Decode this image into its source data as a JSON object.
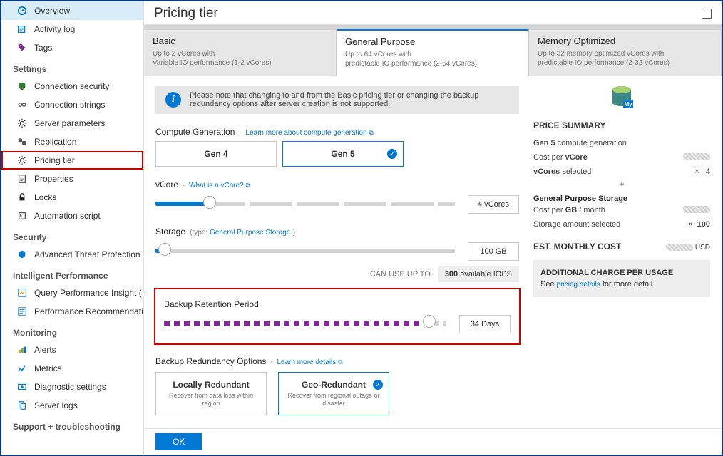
{
  "sidebar": {
    "items": [
      {
        "label": "Overview",
        "icon": "overview",
        "color": "#0078d4",
        "selected": true
      },
      {
        "label": "Activity log",
        "icon": "activity",
        "color": "#0078d4"
      },
      {
        "label": "Tags",
        "icon": "tags",
        "color": "#7b2d8e"
      }
    ],
    "groups": [
      {
        "heading": "Settings",
        "items": [
          {
            "label": "Connection security",
            "icon": "shield",
            "color": "#2f7d32"
          },
          {
            "label": "Connection strings",
            "icon": "strings",
            "color": "#555"
          },
          {
            "label": "Server parameters",
            "icon": "gear",
            "color": "#333"
          },
          {
            "label": "Replication",
            "icon": "replication",
            "color": "#555"
          },
          {
            "label": "Pricing tier",
            "icon": "gear",
            "color": "#555",
            "highlight": true
          },
          {
            "label": "Properties",
            "icon": "properties",
            "color": "#555"
          },
          {
            "label": "Locks",
            "icon": "lock",
            "color": "#222"
          },
          {
            "label": "Automation script",
            "icon": "script",
            "color": "#555"
          }
        ]
      },
      {
        "heading": "Security",
        "items": [
          {
            "label": "Advanced Threat Protection (...",
            "icon": "shield-blue",
            "color": "#0078d4"
          }
        ]
      },
      {
        "heading": "Intelligent Performance",
        "items": [
          {
            "label": "Query Performance Insight (...",
            "icon": "chart",
            "color": "#0078d4"
          },
          {
            "label": "Performance Recommendatio...",
            "icon": "list",
            "color": "#0078d4"
          }
        ]
      },
      {
        "heading": "Monitoring",
        "items": [
          {
            "label": "Alerts",
            "icon": "alert",
            "color": "#e8a800"
          },
          {
            "label": "Metrics",
            "icon": "metrics",
            "color": "#0078d4"
          },
          {
            "label": "Diagnostic settings",
            "icon": "diagnostic",
            "color": "#0078d4"
          },
          {
            "label": "Server logs",
            "icon": "logs",
            "color": "#0078d4"
          }
        ]
      },
      {
        "heading": "Support + troubleshooting",
        "items": []
      }
    ]
  },
  "header": {
    "title": "Pricing tier"
  },
  "tiers": [
    {
      "title": "Basic",
      "desc1": "Up to 2 vCores with",
      "desc2": "Variable IO performance (1-2 vCores)"
    },
    {
      "title": "General Purpose",
      "desc1": "Up to 64 vCores with",
      "desc2": "predictable IO performance (2-64 vCores)",
      "active": true
    },
    {
      "title": "Memory Optimized",
      "desc1": "Up to 32 memory optimized vCores with",
      "desc2": "predictable IO performance (2-32 vCores)"
    }
  ],
  "info_note": "Please note that changing to and from the Basic pricing tier or changing the backup redundancy options after server creation is not supported.",
  "compute": {
    "label": "Compute Generation",
    "link": "Learn more about compute generation",
    "options": [
      {
        "label": "Gen 4"
      },
      {
        "label": "Gen 5",
        "selected": true
      }
    ]
  },
  "vcore": {
    "label": "vCore",
    "link": "What is a vCore?",
    "value": "4 vCores",
    "fill_pct": 18
  },
  "storage": {
    "label": "Storage",
    "type_word": "type:",
    "type_link": "General Purpose Storage",
    "value": "100 GB",
    "fill_pct": 3,
    "can_use": "CAN USE UP TO",
    "iops": "300",
    "iops_suffix": "available IOPS"
  },
  "backup": {
    "label": "Backup Retention Period",
    "value": "34 Days",
    "fill_pct": 94
  },
  "redundancy": {
    "label": "Backup Redundancy Options",
    "link": "Learn more details",
    "options": [
      {
        "title": "Locally Redundant",
        "desc": "Recover from data loss within region"
      },
      {
        "title": "Geo-Redundant",
        "desc": "Recover from regional outage or disaster",
        "selected": true
      }
    ]
  },
  "price": {
    "title": "PRICE SUMMARY",
    "gen_line_a": "Gen 5",
    "gen_line_b": "compute generation",
    "cost_vcore": "Cost per",
    "vcore": "vCore",
    "vcores_sel": "vCores",
    "selected": "selected",
    "vcores_val": "4",
    "times": "×",
    "plus": "+",
    "storage_hdr": "General Purpose Storage",
    "cost_gb": "Cost per",
    "gb": "GB /",
    "month": "month",
    "storage_sel": "Storage amount selected",
    "storage_val": "100",
    "est": "EST. MONTHLY COST",
    "usd": "USD",
    "addl_title": "ADDITIONAL CHARGE PER USAGE",
    "addl_text_a": "See",
    "addl_link": "pricing details",
    "addl_text_b": "for more detail."
  },
  "footer": {
    "ok": "OK"
  },
  "icon_my": "My"
}
